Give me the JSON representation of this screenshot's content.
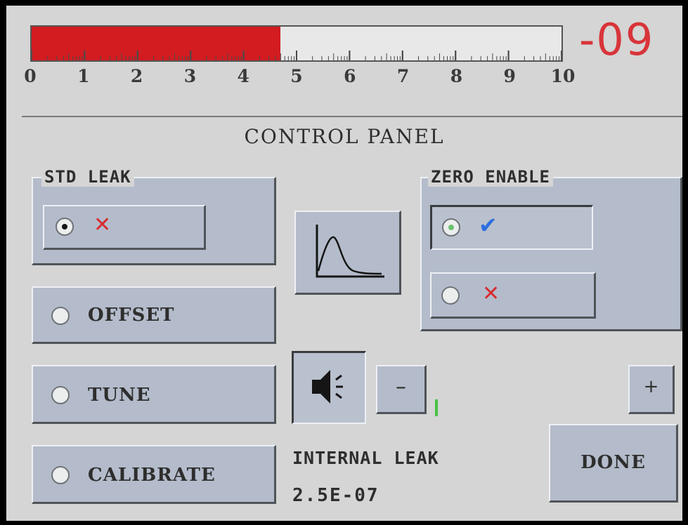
{
  "bar_graph": {
    "fill_fraction": 0.47,
    "fill_color": "#d21c20",
    "scale": [
      "0",
      "1",
      "2",
      "3",
      "4",
      "5",
      "6",
      "7",
      "8",
      "9",
      "10"
    ],
    "exponent": "-09"
  },
  "title": "CONTROL PANEL",
  "std_leak": {
    "label": "STD LEAK",
    "option": {
      "state": "selected",
      "icon": "x-icon",
      "mark": "✕"
    }
  },
  "offset": {
    "label": "OFFSET",
    "selected": false
  },
  "tune": {
    "label": "TUNE",
    "selected": false
  },
  "calibrate": {
    "label": "CALIBRATE",
    "selected": false
  },
  "graph_button": {
    "icon": "peak-graph-icon"
  },
  "zero_enable": {
    "label": "ZERO ENABLE",
    "options": [
      {
        "icon": "check-icon",
        "mark": "✔",
        "selected": true
      },
      {
        "icon": "x-icon",
        "mark": "✕",
        "selected": false
      }
    ]
  },
  "volume": {
    "icon": "speaker-icon",
    "minus_label": "–",
    "plus_label": "+",
    "level_fraction": 0.05,
    "level_color": "#47c247"
  },
  "internal_leak": {
    "label": "INTERNAL LEAK",
    "value": "2.5E-07"
  },
  "done_label": "DONE",
  "colors": {
    "accent_red": "#d72c30",
    "check_blue": "#2b6fe0",
    "button_face": "#b4bccb"
  }
}
